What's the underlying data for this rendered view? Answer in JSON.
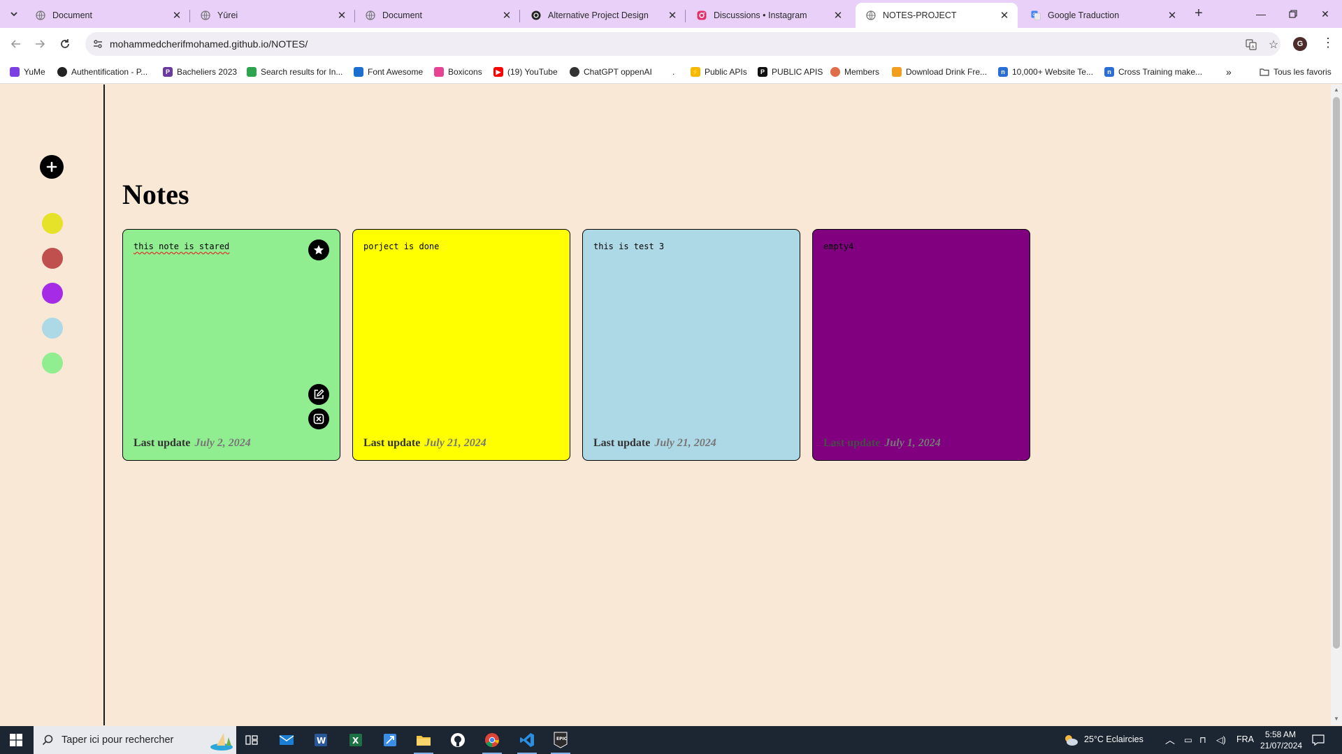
{
  "browser": {
    "tabs": [
      {
        "title": "Document",
        "favicon": "globe-icon",
        "active": false
      },
      {
        "title": "Yūrei",
        "favicon": "globe-icon",
        "active": false
      },
      {
        "title": "Document",
        "favicon": "globe-icon",
        "active": false
      },
      {
        "title": "Alternative Project Design",
        "favicon": "openai-icon",
        "active": false
      },
      {
        "title": "Discussions • Instagram",
        "favicon": "instagram-icon",
        "active": false
      },
      {
        "title": "NOTES-PROJECT",
        "favicon": "globe-icon",
        "active": true
      },
      {
        "title": "Google Traduction",
        "favicon": "google-translate-icon",
        "active": false
      }
    ],
    "address": {
      "url": "mohammedcherifmohamed.github.io/NOTES/"
    },
    "profile_initial": "G",
    "bookmarks": [
      {
        "label": "YuMe",
        "color": "#7b3fe4"
      },
      {
        "label": "Authentification - P...",
        "color": "#222222"
      },
      {
        "label": "Bacheliers 2023",
        "color": "#6a3aa0"
      },
      {
        "label": "Search results for In...",
        "color": "#2ea44f"
      },
      {
        "label": "Font Awesome",
        "color": "#1b6fd1"
      },
      {
        "label": "Boxicons",
        "color": "#e84393"
      },
      {
        "label": "(19) YouTube",
        "color": "#ff0000"
      },
      {
        "label": "ChatGPT oppenAI",
        "color": "#333333"
      },
      {
        "label": ".",
        "color": "#ffffff"
      },
      {
        "label": "Public APIs",
        "color": "#f5b700"
      },
      {
        "label": "PUBLIC APIS",
        "color": "#111111"
      },
      {
        "label": "Members",
        "color": "#e26d4a"
      },
      {
        "label": "Download Drink Fre...",
        "color": "#f29d1d"
      },
      {
        "label": "10,000+ Website Te...",
        "color": "#2b6fd6"
      },
      {
        "label": "Cross Training make...",
        "color": "#2b6fd6"
      }
    ],
    "all_bookmarks_label": "Tous les favoris"
  },
  "app": {
    "heading": "Notes",
    "palette": [
      {
        "name": "yellow",
        "color": "#e6e22a"
      },
      {
        "name": "red",
        "color": "#c0504d"
      },
      {
        "name": "purple",
        "color": "#a52be6"
      },
      {
        "name": "light-blue",
        "color": "#add8e6"
      },
      {
        "name": "light-green",
        "color": "#90ee90"
      }
    ],
    "notes": [
      {
        "text": "this note is stared",
        "last_update_label": "Last update",
        "date": "July 2, 2024",
        "color": "#90ee90",
        "starred": true,
        "spellcheck": true
      },
      {
        "text": "porject is done",
        "last_update_label": "Last update",
        "date": "July 21, 2024",
        "color": "#ffff00",
        "starred": false,
        "spellcheck": false
      },
      {
        "text": "this is test 3",
        "last_update_label": "Last update",
        "date": "July 21, 2024",
        "color": "#add8e6",
        "starred": false,
        "spellcheck": false
      },
      {
        "text": "empty4",
        "last_update_label": "Last update",
        "date": "July 1, 2024",
        "color": "#800080",
        "starred": false,
        "spellcheck": false
      }
    ]
  },
  "taskbar": {
    "search_placeholder": "Taper ici pour rechercher",
    "weather": "25°C  Eclaircies",
    "language": "FRA",
    "time": "5:58 AM",
    "date": "21/07/2024"
  }
}
